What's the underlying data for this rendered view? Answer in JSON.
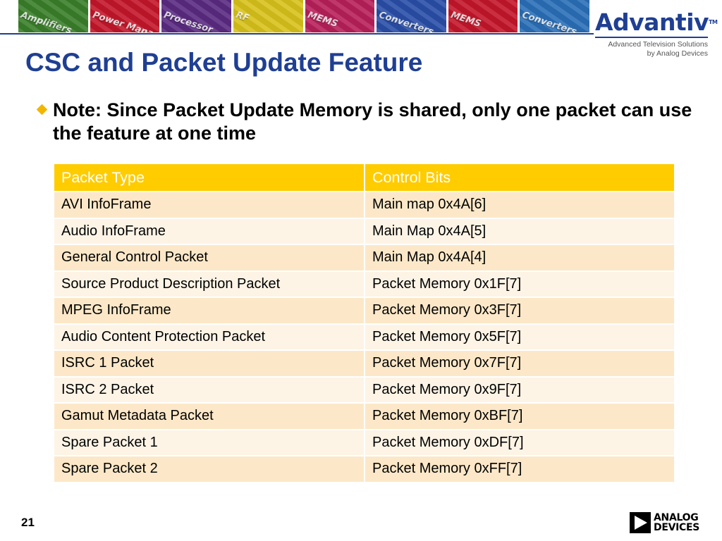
{
  "banner": {
    "tiles": [
      {
        "label": "Amplifiers",
        "color": "#3a7f2a"
      },
      {
        "label": "Power Management",
        "color": "#c4172b"
      },
      {
        "label": "Processor",
        "color": "#5a2a82"
      },
      {
        "label": "RF",
        "color": "#d8c21c"
      },
      {
        "label": "MEMS",
        "color": "#b8205a"
      },
      {
        "label": "Converters",
        "color": "#2a4fa8"
      },
      {
        "label": "MEMS",
        "color": "#c4172b"
      },
      {
        "label": "Converters",
        "color": "#2a6fb8"
      }
    ]
  },
  "logo": {
    "name": "Advantiv",
    "tm": "TM",
    "tagline_1": "Advanced Television Solutions",
    "tagline_2": "by Analog Devices"
  },
  "title": "CSC and Packet Update Feature",
  "note": "Note: Since Packet Update Memory is shared, only one packet can use the feature at one time",
  "table": {
    "headers": [
      "Packet Type",
      "Control Bits"
    ],
    "rows": [
      [
        "AVI InfoFrame",
        "Main map 0x4A[6]"
      ],
      [
        "Audio InfoFrame",
        "Main Map 0x4A[5]"
      ],
      [
        "General Control Packet",
        "Main Map 0x4A[4]"
      ],
      [
        "Source Product Description Packet",
        "Packet Memory 0x1F[7]"
      ],
      [
        "MPEG InfoFrame",
        "Packet Memory 0x3F[7]"
      ],
      [
        "Audio Content Protection Packet",
        "Packet Memory 0x5F[7]"
      ],
      [
        "ISRC 1 Packet",
        "Packet Memory 0x7F[7]"
      ],
      [
        "ISRC 2 Packet",
        "Packet Memory 0x9F[7]"
      ],
      [
        "Gamut Metadata Packet",
        "Packet Memory 0xBF[7]"
      ],
      [
        "Spare Packet 1",
        "Packet Memory 0xDF[7]"
      ],
      [
        "Spare Packet 2",
        "Packet Memory 0xFF[7]"
      ]
    ]
  },
  "footer": {
    "page_number": "21",
    "brand_line_1": "ANALOG",
    "brand_line_2": "DEVICES"
  }
}
